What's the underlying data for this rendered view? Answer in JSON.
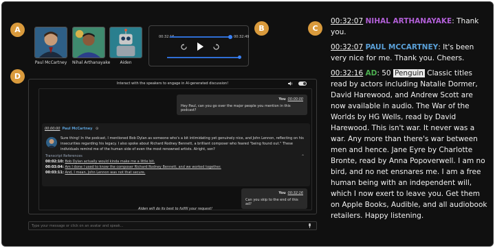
{
  "badges": {
    "a": "A",
    "b": "B",
    "c": "C",
    "d": "D"
  },
  "speakers": [
    {
      "name": "Paul McCartney",
      "avatar": "paul-mccartney-portrait"
    },
    {
      "name": "Nihal Arthanayake",
      "avatar": "nihal-arthanayake-portrait"
    },
    {
      "name": "Aiden",
      "avatar": "robot-portrait"
    }
  ],
  "player": {
    "current_time": "00:32:16",
    "total_time": "00:32:49",
    "progress": 0.98,
    "volume": 1.0,
    "icons": [
      "rewind-icon",
      "play-icon",
      "forward-icon"
    ]
  },
  "chat": {
    "header": "Interact with the speakers to engage in AI-generated discussion!",
    "messages": [
      {
        "role": "user",
        "author": "You",
        "time": "00:00:00",
        "text": "Hey Paul, can you go over the major people you mention in this podcast?"
      },
      {
        "role": "assistant",
        "time": "00:00:00",
        "author": "Paul McCartney",
        "text": "Sure thing! In the podcast, I mentioned Bob Dylan as someone who's a bit intimidating yet genuinely nice, and John Lennon, reflecting on his insecurities regarding his legacy. I also spoke about Richard Rodney Bennett, a brilliant composer who feared \"being found out.\" These individuals remind me of the human side of even the most renowned artists. Alright, son?",
        "refs_title": "Transcript References",
        "refs": [
          {
            "time": "00:02:10:",
            "text": "Bob Dylan actually would kinda make me a little bit."
          },
          {
            "time": "00:03:04:",
            "text": "Am I done I used to know the composer Richard Rodney Bennett, and we worked together."
          },
          {
            "time": "00:03:11:",
            "text": "And, I mean, John Lennon was not that secure."
          }
        ]
      },
      {
        "role": "user",
        "author": "You",
        "time": "00:32:16",
        "text": "Can you skip to the end of this ad?"
      }
    ],
    "status": "Aiden will do its best to fulfill your request!",
    "input_placeholder": "Type your message or click on an avatar and speak..."
  },
  "transcript": [
    {
      "time": "00:32:07",
      "speaker": "NIHAL ARTHANAYAKE",
      "color": "#b15fd6",
      "text": "Thank you."
    },
    {
      "time": "00:32:07",
      "speaker": "PAUL MCCARTNEY",
      "color": "#5aa0d8",
      "text": "It's been very nice for me. Thank you. Cheers."
    },
    {
      "time": "00:32:16",
      "speaker": "AD",
      "color": "#4caf50",
      "pre": "50",
      "highlight": "Penguin",
      "text": "Classic titles read by actors including Natalie Dormer, David Harewood, and Andrew Scott are now available in audio. The War of the Worlds by HG Wells, read by David Harewood. This isn't war. It never was a war. Any more than there's war between men and hence. Jane Eyre by Charlotte Bronte, read by Anna Popoverwell. I am no bird, and no net ensnares me. I am a free human being with an independent will, which I now exert to leave you. Get them on Apple Books, Audible, and all audiobook retailers. Happy listening."
    }
  ]
}
